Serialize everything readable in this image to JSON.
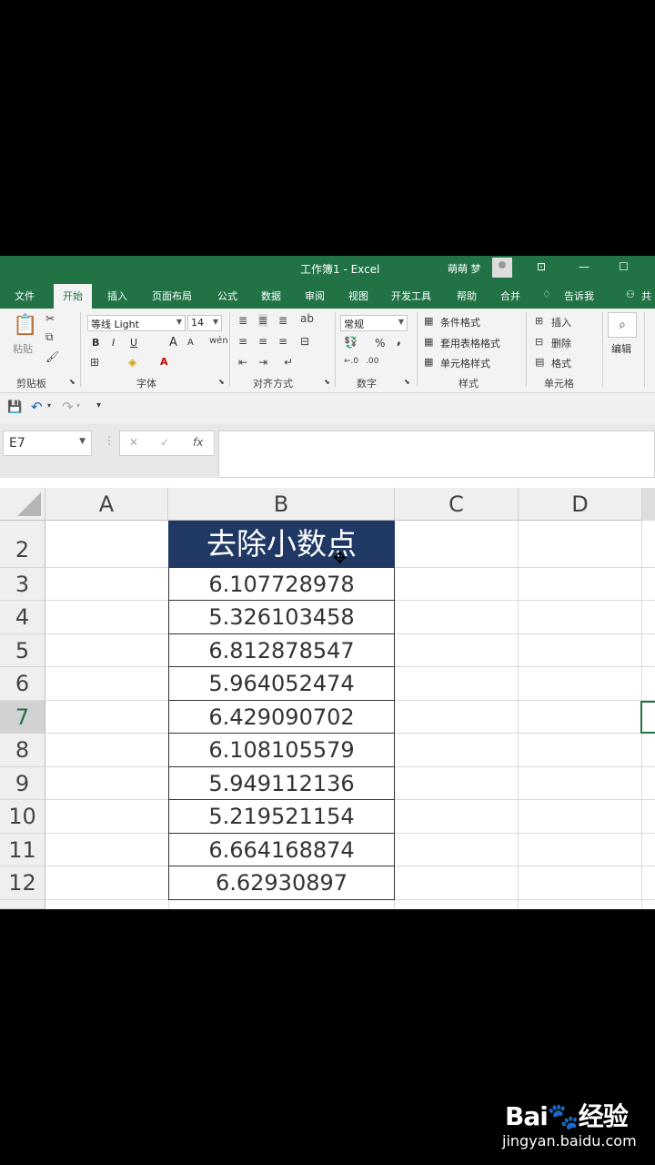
{
  "window": {
    "title": "工作簿1  -  Excel",
    "user_name": "萌萌 梦",
    "ribbon_display_icon": "ribbon-display-icon",
    "minimize_icon": "minimize-icon",
    "maximize_icon": "maximize-icon"
  },
  "tabs": [
    "文件",
    "开始",
    "插入",
    "页面布局",
    "公式",
    "数据",
    "审阅",
    "视图",
    "开发工具",
    "帮助",
    "合并",
    "告诉我",
    "共"
  ],
  "ribbon": {
    "clipboard": {
      "paste_label": "粘贴",
      "group_label": "剪贴板"
    },
    "font": {
      "font_name": "等线 Light",
      "font_size": "14",
      "bold": "B",
      "italic": "I",
      "underline": "U",
      "grow": "A",
      "shrink": "A",
      "color_a": "A",
      "group_label": "字体"
    },
    "alignment": {
      "group_label": "对齐方式"
    },
    "number": {
      "format": "常规",
      "percent": "%",
      "comma": ",",
      "group_label": "数字"
    },
    "styles": {
      "conditional": "条件格式",
      "table": "套用表格格式",
      "cell_styles": "单元格样式",
      "group_label": "样式"
    },
    "cells": {
      "insert": "插入",
      "delete": "删除",
      "format": "格式",
      "group_label": "单元格"
    },
    "editing": {
      "label": "编辑"
    }
  },
  "formula_bar": {
    "name_box": "E7",
    "fx_label": "fx",
    "formula": ""
  },
  "grid": {
    "columns": [
      "A",
      "B",
      "C",
      "D"
    ],
    "rows": [
      "2",
      "3",
      "4",
      "5",
      "6",
      "7",
      "8",
      "9",
      "10",
      "11",
      "12"
    ],
    "selected_row": "7",
    "header_cell": "去除小数点",
    "values": [
      "6.107728978",
      "5.326103458",
      "6.812878547",
      "5.964052474",
      "6.429090702",
      "6.108105579",
      "5.949112136",
      "5.219521154",
      "6.664168874",
      "6.62930897"
    ],
    "header_fill": "#1f3864",
    "accent": "#217346"
  },
  "watermark": {
    "brand_left": "Bai",
    "brand_right": "经验",
    "url": "jingyan.baidu.com"
  }
}
